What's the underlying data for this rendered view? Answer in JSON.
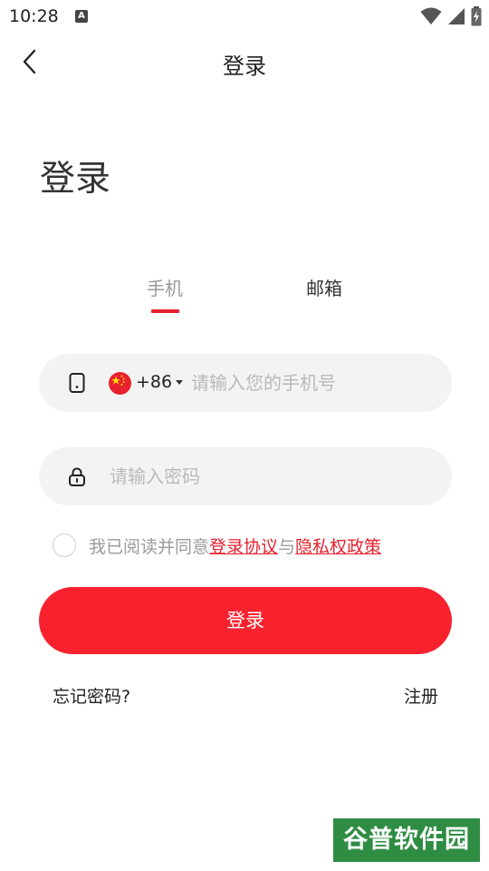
{
  "status_bar": {
    "time": "10:28",
    "notification_icon_letter": "A"
  },
  "app_bar": {
    "title": "登录"
  },
  "page_title": "登录",
  "tabs": [
    {
      "label": "手机",
      "active": true
    },
    {
      "label": "邮箱",
      "active": false
    }
  ],
  "phone_field": {
    "country_code": "+86",
    "placeholder": "请输入您的手机号",
    "value": ""
  },
  "password_field": {
    "placeholder": "请输入密码",
    "value": ""
  },
  "agreement": {
    "prefix": "我已阅读并同意",
    "terms_link": "登录协议",
    "joiner": "与",
    "privacy_link": "隐私权政策",
    "checked": false
  },
  "login_button": "登录",
  "forgot_password": "忘记密码?",
  "register": "注册",
  "watermark": "谷普软件园",
  "colors": {
    "accent": "#f8212e",
    "field_bg": "#f3f3f3",
    "placeholder": "#b9b9b9",
    "watermark_bg": "#2f8d43"
  }
}
